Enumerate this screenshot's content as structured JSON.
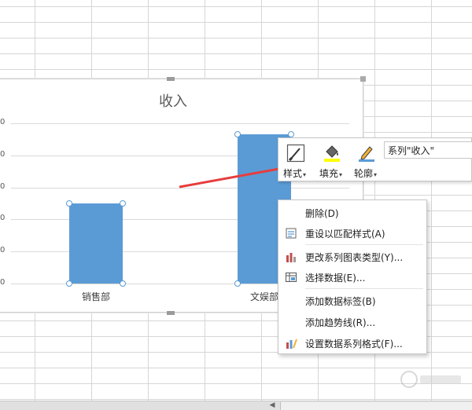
{
  "spreadsheet": {
    "grid_color": "#d6d6d6"
  },
  "chart_data": {
    "type": "bar",
    "title": "收入",
    "categories": [
      "销售部",
      "文娱部"
    ],
    "values": [
      50,
      93
    ],
    "ylim": [
      0,
      100
    ],
    "yticks": [
      "0",
      "20",
      "40",
      "60",
      "80",
      "100"
    ],
    "ytick_labels_visible": [
      "0",
      "0",
      "0",
      "0",
      "0",
      "0"
    ],
    "bar_color": "#5b9bd5",
    "selected_series": true,
    "grid": true
  },
  "mini_toolbar": {
    "style_label": "样式",
    "fill_label": "填充",
    "outline_label": "轮廓",
    "series_selector": "系列\"收入\"",
    "fill_color": "#ffff00",
    "outline_color": "#5b9bd5"
  },
  "context_menu": {
    "items": [
      {
        "label": "删除(D)",
        "icon": "none"
      },
      {
        "label": "重设以匹配样式(A)",
        "icon": "reset-style-icon"
      },
      {
        "label": "更改系列图表类型(Y)...",
        "icon": "chart-type-icon"
      },
      {
        "label": "选择数据(E)...",
        "icon": "select-data-icon"
      },
      {
        "label": "添加数据标签(B)",
        "icon": "none"
      },
      {
        "label": "添加趋势线(R)...",
        "icon": "none"
      },
      {
        "label": "设置数据系列格式(F)...",
        "icon": "format-series-icon"
      }
    ]
  },
  "annotation": {
    "arrow_color": "#e83c3c"
  }
}
